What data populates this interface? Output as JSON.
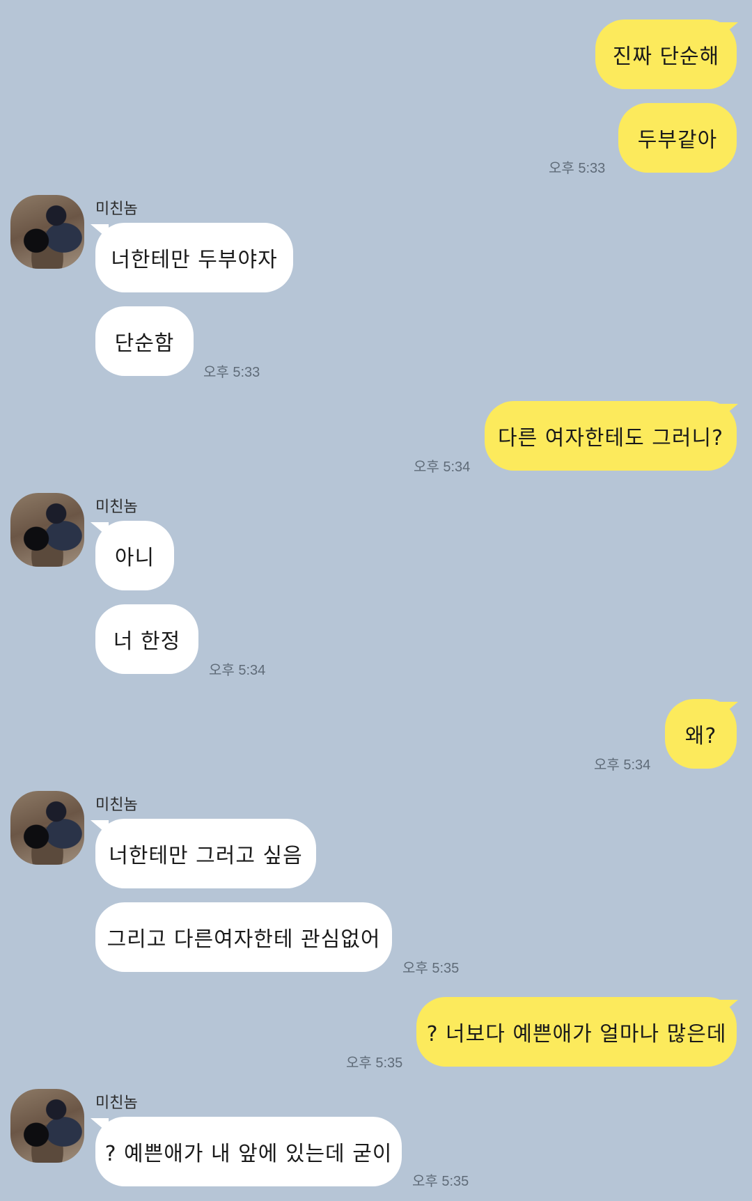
{
  "messages": [
    {
      "text": "진짜 단순해"
    },
    {
      "text": "두부같아",
      "time": "오후 5:33"
    },
    {
      "sender": "미친놈",
      "text": "너한테만 두부야자"
    },
    {
      "text": "단순함",
      "time": "오후 5:33"
    },
    {
      "text": "다른 여자한테도 그러니?",
      "time": "오후 5:34"
    },
    {
      "sender": "미친놈",
      "text": "아니"
    },
    {
      "text": "너 한정",
      "time": "오후 5:34"
    },
    {
      "text": "왜?",
      "time": "오후 5:34"
    },
    {
      "sender": "미친놈",
      "text": "너한테만 그러고 싶음"
    },
    {
      "text": "그리고 다른여자한테 관심없어",
      "time": "오후 5:35"
    },
    {
      "text": "? 너보다 예쁜애가 얼마나 많은데",
      "time": "오후 5:35"
    },
    {
      "sender": "미친놈",
      "text": "? 예쁜애가 내 앞에 있는데 굳이",
      "time": "오후 5:35"
    }
  ],
  "colors": {
    "background": "#b6c5d6",
    "my_bubble": "#fcea5c",
    "their_bubble": "#ffffff"
  }
}
